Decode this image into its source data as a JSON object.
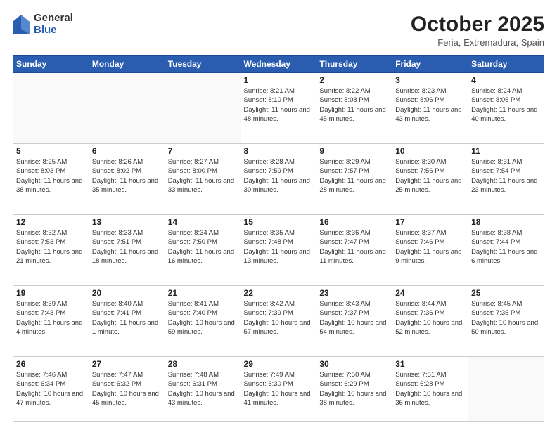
{
  "logo": {
    "general": "General",
    "blue": "Blue"
  },
  "header": {
    "month": "October 2025",
    "location": "Feria, Extremadura, Spain"
  },
  "weekdays": [
    "Sunday",
    "Monday",
    "Tuesday",
    "Wednesday",
    "Thursday",
    "Friday",
    "Saturday"
  ],
  "weeks": [
    [
      {
        "day": "",
        "sunrise": "",
        "sunset": "",
        "daylight": ""
      },
      {
        "day": "",
        "sunrise": "",
        "sunset": "",
        "daylight": ""
      },
      {
        "day": "",
        "sunrise": "",
        "sunset": "",
        "daylight": ""
      },
      {
        "day": "1",
        "sunrise": "Sunrise: 8:21 AM",
        "sunset": "Sunset: 8:10 PM",
        "daylight": "Daylight: 11 hours and 48 minutes."
      },
      {
        "day": "2",
        "sunrise": "Sunrise: 8:22 AM",
        "sunset": "Sunset: 8:08 PM",
        "daylight": "Daylight: 11 hours and 45 minutes."
      },
      {
        "day": "3",
        "sunrise": "Sunrise: 8:23 AM",
        "sunset": "Sunset: 8:06 PM",
        "daylight": "Daylight: 11 hours and 43 minutes."
      },
      {
        "day": "4",
        "sunrise": "Sunrise: 8:24 AM",
        "sunset": "Sunset: 8:05 PM",
        "daylight": "Daylight: 11 hours and 40 minutes."
      }
    ],
    [
      {
        "day": "5",
        "sunrise": "Sunrise: 8:25 AM",
        "sunset": "Sunset: 8:03 PM",
        "daylight": "Daylight: 11 hours and 38 minutes."
      },
      {
        "day": "6",
        "sunrise": "Sunrise: 8:26 AM",
        "sunset": "Sunset: 8:02 PM",
        "daylight": "Daylight: 11 hours and 35 minutes."
      },
      {
        "day": "7",
        "sunrise": "Sunrise: 8:27 AM",
        "sunset": "Sunset: 8:00 PM",
        "daylight": "Daylight: 11 hours and 33 minutes."
      },
      {
        "day": "8",
        "sunrise": "Sunrise: 8:28 AM",
        "sunset": "Sunset: 7:59 PM",
        "daylight": "Daylight: 11 hours and 30 minutes."
      },
      {
        "day": "9",
        "sunrise": "Sunrise: 8:29 AM",
        "sunset": "Sunset: 7:57 PM",
        "daylight": "Daylight: 11 hours and 28 minutes."
      },
      {
        "day": "10",
        "sunrise": "Sunrise: 8:30 AM",
        "sunset": "Sunset: 7:56 PM",
        "daylight": "Daylight: 11 hours and 25 minutes."
      },
      {
        "day": "11",
        "sunrise": "Sunrise: 8:31 AM",
        "sunset": "Sunset: 7:54 PM",
        "daylight": "Daylight: 11 hours and 23 minutes."
      }
    ],
    [
      {
        "day": "12",
        "sunrise": "Sunrise: 8:32 AM",
        "sunset": "Sunset: 7:53 PM",
        "daylight": "Daylight: 11 hours and 21 minutes."
      },
      {
        "day": "13",
        "sunrise": "Sunrise: 8:33 AM",
        "sunset": "Sunset: 7:51 PM",
        "daylight": "Daylight: 11 hours and 18 minutes."
      },
      {
        "day": "14",
        "sunrise": "Sunrise: 8:34 AM",
        "sunset": "Sunset: 7:50 PM",
        "daylight": "Daylight: 11 hours and 16 minutes."
      },
      {
        "day": "15",
        "sunrise": "Sunrise: 8:35 AM",
        "sunset": "Sunset: 7:48 PM",
        "daylight": "Daylight: 11 hours and 13 minutes."
      },
      {
        "day": "16",
        "sunrise": "Sunrise: 8:36 AM",
        "sunset": "Sunset: 7:47 PM",
        "daylight": "Daylight: 11 hours and 11 minutes."
      },
      {
        "day": "17",
        "sunrise": "Sunrise: 8:37 AM",
        "sunset": "Sunset: 7:46 PM",
        "daylight": "Daylight: 11 hours and 9 minutes."
      },
      {
        "day": "18",
        "sunrise": "Sunrise: 8:38 AM",
        "sunset": "Sunset: 7:44 PM",
        "daylight": "Daylight: 11 hours and 6 minutes."
      }
    ],
    [
      {
        "day": "19",
        "sunrise": "Sunrise: 8:39 AM",
        "sunset": "Sunset: 7:43 PM",
        "daylight": "Daylight: 11 hours and 4 minutes."
      },
      {
        "day": "20",
        "sunrise": "Sunrise: 8:40 AM",
        "sunset": "Sunset: 7:41 PM",
        "daylight": "Daylight: 11 hours and 1 minute."
      },
      {
        "day": "21",
        "sunrise": "Sunrise: 8:41 AM",
        "sunset": "Sunset: 7:40 PM",
        "daylight": "Daylight: 10 hours and 59 minutes."
      },
      {
        "day": "22",
        "sunrise": "Sunrise: 8:42 AM",
        "sunset": "Sunset: 7:39 PM",
        "daylight": "Daylight: 10 hours and 57 minutes."
      },
      {
        "day": "23",
        "sunrise": "Sunrise: 8:43 AM",
        "sunset": "Sunset: 7:37 PM",
        "daylight": "Daylight: 10 hours and 54 minutes."
      },
      {
        "day": "24",
        "sunrise": "Sunrise: 8:44 AM",
        "sunset": "Sunset: 7:36 PM",
        "daylight": "Daylight: 10 hours and 52 minutes."
      },
      {
        "day": "25",
        "sunrise": "Sunrise: 8:45 AM",
        "sunset": "Sunset: 7:35 PM",
        "daylight": "Daylight: 10 hours and 50 minutes."
      }
    ],
    [
      {
        "day": "26",
        "sunrise": "Sunrise: 7:46 AM",
        "sunset": "Sunset: 6:34 PM",
        "daylight": "Daylight: 10 hours and 47 minutes."
      },
      {
        "day": "27",
        "sunrise": "Sunrise: 7:47 AM",
        "sunset": "Sunset: 6:32 PM",
        "daylight": "Daylight: 10 hours and 45 minutes."
      },
      {
        "day": "28",
        "sunrise": "Sunrise: 7:48 AM",
        "sunset": "Sunset: 6:31 PM",
        "daylight": "Daylight: 10 hours and 43 minutes."
      },
      {
        "day": "29",
        "sunrise": "Sunrise: 7:49 AM",
        "sunset": "Sunset: 6:30 PM",
        "daylight": "Daylight: 10 hours and 41 minutes."
      },
      {
        "day": "30",
        "sunrise": "Sunrise: 7:50 AM",
        "sunset": "Sunset: 6:29 PM",
        "daylight": "Daylight: 10 hours and 38 minutes."
      },
      {
        "day": "31",
        "sunrise": "Sunrise: 7:51 AM",
        "sunset": "Sunset: 6:28 PM",
        "daylight": "Daylight: 10 hours and 36 minutes."
      },
      {
        "day": "",
        "sunrise": "",
        "sunset": "",
        "daylight": ""
      }
    ]
  ]
}
